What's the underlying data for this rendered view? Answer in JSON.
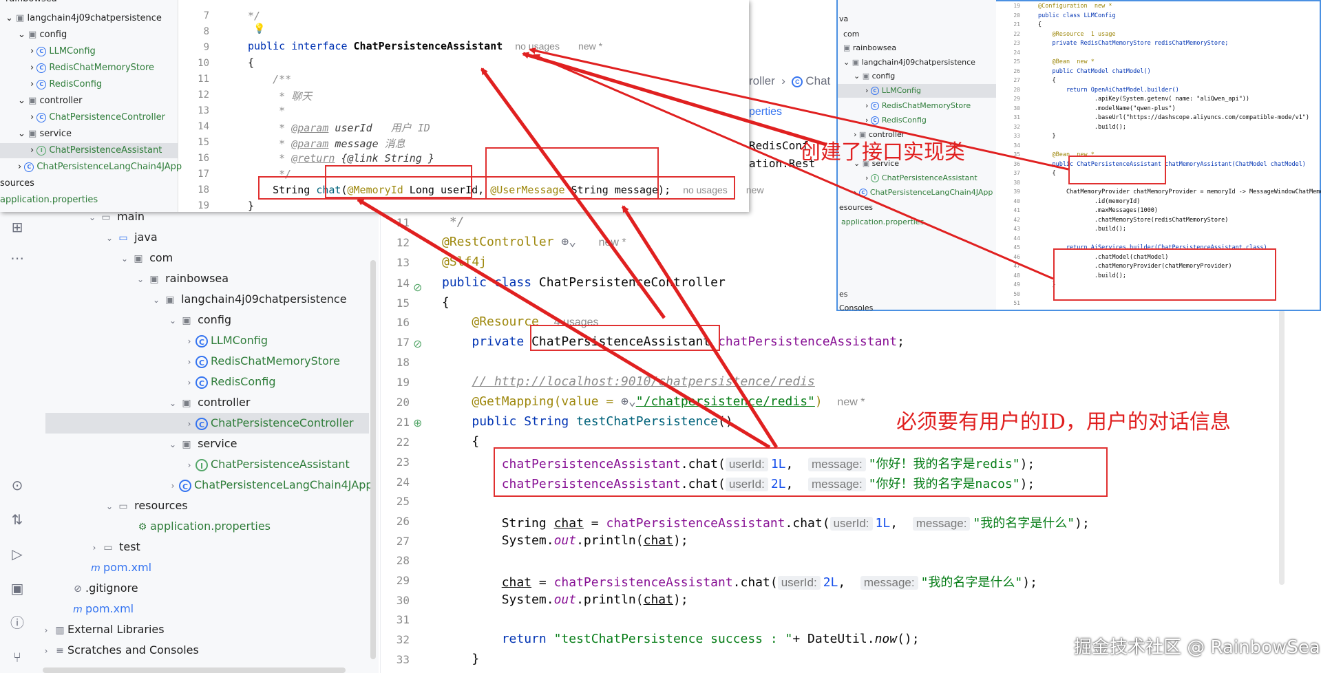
{
  "main_tree": {
    "rows": [
      {
        "label": "main",
        "type": "folder"
      },
      {
        "label": "java",
        "type": "folder"
      },
      {
        "label": "com",
        "type": "package"
      },
      {
        "label": "rainbowsea",
        "type": "package"
      },
      {
        "label": "langchain4j09chatpersistence",
        "type": "package"
      },
      {
        "label": "config",
        "type": "package"
      },
      {
        "label": "LLMConfig",
        "type": "class"
      },
      {
        "label": "RedisChatMemoryStore",
        "type": "class"
      },
      {
        "label": "RedisConfig",
        "type": "class"
      },
      {
        "label": "controller",
        "type": "package"
      },
      {
        "label": "ChatPersistenceController",
        "type": "class"
      },
      {
        "label": "service",
        "type": "package"
      },
      {
        "label": "ChatPersistenceAssistant",
        "type": "interface"
      },
      {
        "label": "ChatPersistenceLangChain4JApp",
        "type": "class"
      },
      {
        "label": "resources",
        "type": "folder"
      },
      {
        "label": "application.properties",
        "type": "file"
      },
      {
        "label": "test",
        "type": "folder"
      },
      {
        "label": "pom.xml",
        "type": "maven"
      },
      {
        "label": ".gitignore",
        "type": "file"
      },
      {
        "label": "pom.xml",
        "type": "maven"
      },
      {
        "label": "External Libraries",
        "type": "lib"
      },
      {
        "label": "Scratches and Consoles",
        "type": "scratch"
      }
    ]
  },
  "main_editor": {
    "line_numbers": [
      "11",
      "12",
      "13",
      "14",
      "15",
      "16",
      "17",
      "18",
      "19",
      "20",
      "21",
      "22",
      "23",
      "24",
      "25",
      "26",
      "27",
      "28",
      "29",
      "30",
      "31",
      "32",
      "33"
    ],
    "comment_close": " */",
    "rest_controller": "@RestController",
    "new_marker": "new *",
    "slf4j": "@Slf4j",
    "class_decl_kw": "public class ",
    "class_name": "ChatPersistenceController",
    "open_brace": "{",
    "resource_ann": "@Resource",
    "resource_usages": "4 usages",
    "private_kw": "private ",
    "field_type": "ChatPersistenceAssistant",
    "field_name": "chatPersistenceAssistant",
    "url_comment": "// http://localhost:9010/chatpersistence/redis",
    "get_mapping": "@GetMapping(value = ",
    "mapping_path": "\"/chatpersistence/redis\"",
    "close_paren": ")",
    "method_decl": "public String ",
    "method_name": "testChatPersistence",
    "method_parens": "()",
    "call_prefix": "chatPersistenceAssistant",
    "call_chat": ".chat(",
    "hint_userid": "userId:",
    "hint_message": "message:",
    "arg1": "1L",
    "arg2": "2L",
    "msg1": "\"你好！我的名字是redis\"",
    "msg2": "\"你好！我的名字是nacos\"",
    "msg3": "\"我的名字是什么\"",
    "call_end": ");",
    "string_kw": "String ",
    "chat_var": "chat",
    "eq": " = ",
    "sys_out": "System.",
    "out": "out",
    "println": ".println(",
    "return_kw": "return ",
    "return_str": "\"testChatPersistence success : \"",
    "date_util": "+ DateUtil.",
    "now": "now",
    "now_end": "();",
    "close_brace": "}",
    "tab_fragment_1": "roller",
    "tab_fragment_2": "Chat",
    "tab_fragment_3": "perties",
    "partial_1": "RedisConf",
    "partial_2": "ation.Rest"
  },
  "overlay_left": {
    "tree": [
      {
        "label": "rainbowsea"
      },
      {
        "label": "langchain4j09chatpersistence"
      },
      {
        "label": "config"
      },
      {
        "label": "LLMConfig"
      },
      {
        "label": "RedisChatMemoryStore"
      },
      {
        "label": "RedisConfig"
      },
      {
        "label": "controller"
      },
      {
        "label": "ChatPersistenceController"
      },
      {
        "label": "service"
      },
      {
        "label": "ChatPersistenceAssistant"
      },
      {
        "label": "ChatPersistenceLangChain4JApp"
      },
      {
        "label": "sources"
      },
      {
        "label": "application.properties"
      }
    ],
    "line_numbers": [
      "7",
      "8",
      "9",
      "10",
      "11",
      "12",
      "13",
      "14",
      "15",
      "16",
      "17",
      "18",
      "19"
    ],
    "l7": "*/",
    "l9_kw": "public interface ",
    "l9_name": "ChatPersistenceAssistant",
    "l9_usages": "no usages",
    "l9_new": "new *",
    "l10": "{",
    "l11": "/**",
    "l12": "* 聊天",
    "l13": "*",
    "l14_tag": "@param",
    "l14_name": " userId",
    "l14_desc": "   用户 ID",
    "l15_tag": "@param",
    "l15_name": " message",
    "l15_desc": " 消息",
    "l16_tag": "@return",
    "l16_rest": " {@link String }",
    "l17": "*/",
    "l18_a": "String ",
    "l18_fn": "chat",
    "l18_ann1": "@MemoryId",
    "l18_p1": " Long userId, ",
    "l18_ann2": "@UserMessage",
    "l18_p2": " String message);",
    "l18_usages": "no usages",
    "l18_new": "new",
    "l19": "}"
  },
  "overlay_right": {
    "tree": [
      {
        "label": "va"
      },
      {
        "label": "com"
      },
      {
        "label": "rainbowsea"
      },
      {
        "label": "langchain4j09chatpersistence"
      },
      {
        "label": "config"
      },
      {
        "label": "LLMConfig"
      },
      {
        "label": "RedisChatMemoryStore"
      },
      {
        "label": "RedisConfig"
      },
      {
        "label": "controller"
      },
      {
        "label": "service"
      },
      {
        "label": "ChatPersistenceAssistant"
      },
      {
        "label": "ChatPersistenceLangChain4JApp"
      },
      {
        "label": "esources"
      },
      {
        "label": "application.properties"
      },
      {
        "label": "es"
      },
      {
        "label": "Consoles"
      }
    ],
    "line_numbers": [
      "19",
      "20",
      "21",
      "22",
      "23",
      "24",
      "25",
      "26",
      "27",
      "28",
      "29",
      "30",
      "31",
      "32",
      "33",
      "34",
      "35",
      "36",
      "37",
      "38",
      "39",
      "40",
      "41",
      "42",
      "43",
      "44",
      "45",
      "46",
      "47",
      "48",
      "49",
      "50",
      "51"
    ],
    "code": [
      "@Configuration  new *",
      "public class LLMConfig",
      "{",
      "    @Resource  1 usage",
      "    private RedisChatMemoryStore redisChatMemoryStore;",
      "",
      "    @Bean  new *",
      "    public ChatModel chatModel()",
      "    {",
      "        return OpenAiChatModel.builder()",
      "                .apiKey(System.getenv( name: \"aliQwen_api\"))",
      "                .modelName(\"qwen-plus\")",
      "                .baseUrl(\"https://dashscope.aliyuncs.com/compatible-mode/v1\")",
      "                .build();",
      "    }",
      "",
      "    @Bean  new *",
      "    public ChatPersistenceAssistant chatMemoryAssistant(ChatModel chatModel)",
      "    {",
      "",
      "        ChatMemoryProvider chatMemoryProvider = memoryId -> MessageWindowChatMemory.",
      "                .id(memoryId)",
      "                .maxMessages(1000)",
      "                .chatMemoryStore(redisChatMemoryStore)",
      "                .build();",
      "",
      "        return AiServices.builder(ChatPersistenceAssistant.class)",
      "                .chatModel(chatModel)",
      "                .chatMemoryProvider(chatMemoryProvider)",
      "                .build();",
      "    }",
      "",
      ""
    ]
  },
  "annotations": {
    "note_impl": "创建了接口实现类",
    "note_userid": "必须要有用户的ID，用户的对话信息",
    "watermark": "掘金技术社区 @ RainbowSea"
  },
  "colors": {
    "arrow_red": "#e02020",
    "keyword_blue": "#0033b3",
    "annotation_olive": "#9e880d",
    "string_green": "#067d17",
    "field_purple": "#871094"
  }
}
